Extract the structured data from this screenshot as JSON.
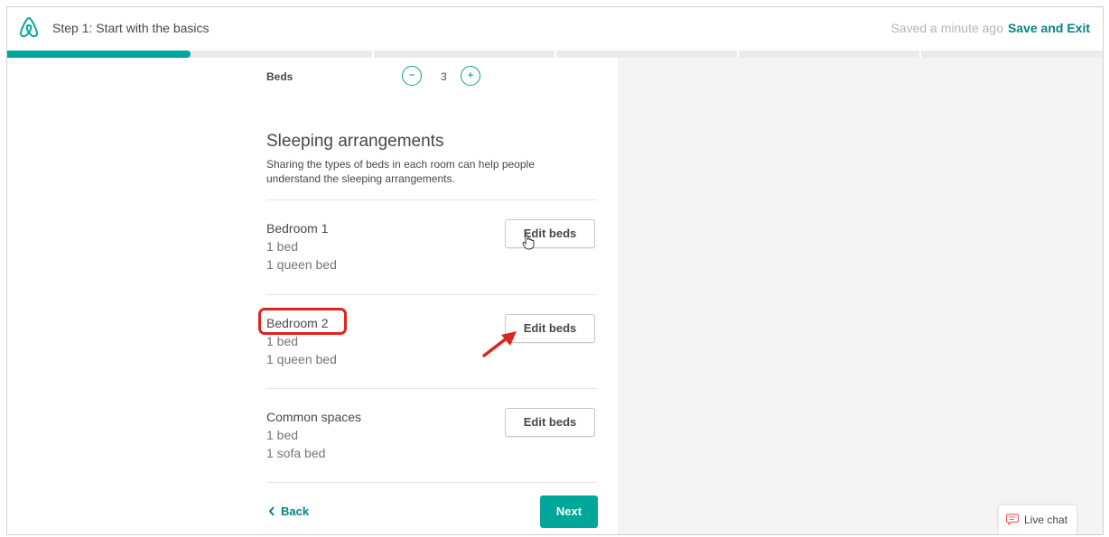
{
  "header": {
    "step_title": "Step 1: Start with the basics",
    "saved_status": "Saved a minute ago",
    "separator": "·",
    "save_exit_label": "Save and Exit",
    "logo_icon": "airbnb-logo-icon"
  },
  "progress": {
    "fraction": 0.167,
    "segments": 6
  },
  "beds": {
    "label": "Beds",
    "value": "3",
    "decrement_symbol": "−",
    "increment_symbol": "+"
  },
  "sleeping": {
    "title": "Sleeping arrangements",
    "description": "Sharing the types of beds in each room can help people understand the sleeping arrangements."
  },
  "rooms": [
    {
      "name": "Bedroom 1",
      "bed_count": "1 bed",
      "bed_type": "1 queen bed",
      "button_label": "Edit beds"
    },
    {
      "name": "Bedroom 2",
      "bed_count": "1 bed",
      "bed_type": "1 queen bed",
      "button_label": "Edit beds"
    },
    {
      "name": "Common spaces",
      "bed_count": "1 bed",
      "bed_type": "1 sofa bed",
      "button_label": "Edit beds"
    }
  ],
  "footer": {
    "back_label": "Back",
    "back_icon": "chevron-left-icon",
    "next_label": "Next"
  },
  "livechat": {
    "label": "Live chat",
    "icon": "chat-bubble-icon"
  },
  "colors": {
    "accent": "#00a699",
    "link": "#008489",
    "highlight": "#e0241b",
    "brand": "#ff5a5f"
  }
}
